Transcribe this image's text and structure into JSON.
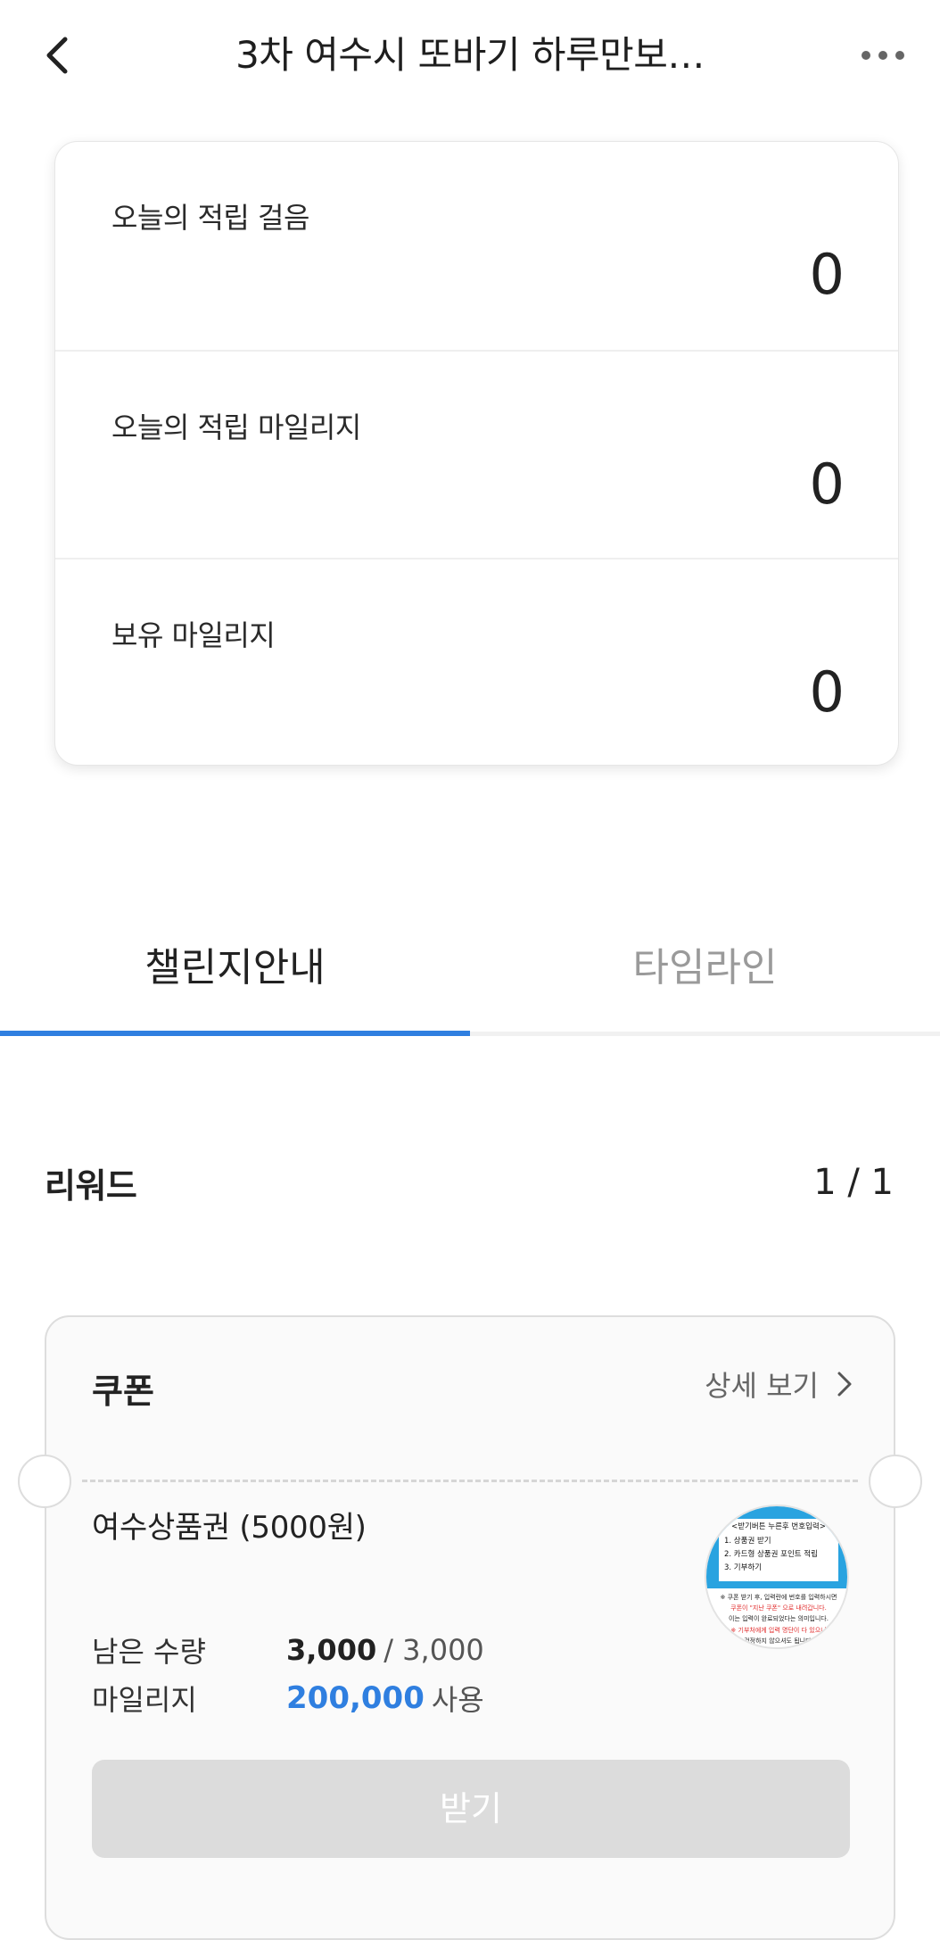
{
  "header": {
    "title": "3차 여수시 또바기 하루만보…",
    "back_icon": "chevron-left-icon",
    "more_icon": "more-horizontal-icon"
  },
  "stats": [
    {
      "label": "오늘의 적립 걸음",
      "value": "0"
    },
    {
      "label": "오늘의 적립 마일리지",
      "value": "0"
    },
    {
      "label": "보유 마일리지",
      "value": "0"
    }
  ],
  "tabs": [
    {
      "label": "챌린지안내",
      "active": true
    },
    {
      "label": "타임라인",
      "active": false
    }
  ],
  "reward": {
    "title": "리워드",
    "pager": "1 / 1",
    "coupon": {
      "type": "쿠폰",
      "detail_link": "상세 보기",
      "name": "여수상품권 (5000원)",
      "remaining_label": "남은 수량",
      "remaining": "3,000",
      "remaining_total": "/ 3,000",
      "mileage_label": "마일리지",
      "mileage": "200,000",
      "mileage_suffix": "사용",
      "receive_button": "받기",
      "image_text": {
        "line1": "<받기버튼 누른후 번호입력>",
        "line2": "1. 상품권 받기",
        "line3": "2. 카드형 상품권 포인트 적립",
        "line4": "3. 기부하기",
        "line5": "※ 쿠폰 받기 후, 입력란에 번호를 입력하시면",
        "line6": "쿠폰이 \"지난 쿠폰\" 으로 내려갑니다.",
        "line7": "이는 입력이 완료되었다는 의미입니다.",
        "line8": "※ 기부처에게 입력 명단이 다 있으니",
        "line9": "걱정하지 않으셔도 됩니다."
      }
    }
  },
  "colors": {
    "accent": "#2f7fe0",
    "disabled_button": "#dcdcdc",
    "inactive_tab": "#9a9a9a",
    "image_blue": "#29a3e0",
    "image_red": "#e02828"
  }
}
